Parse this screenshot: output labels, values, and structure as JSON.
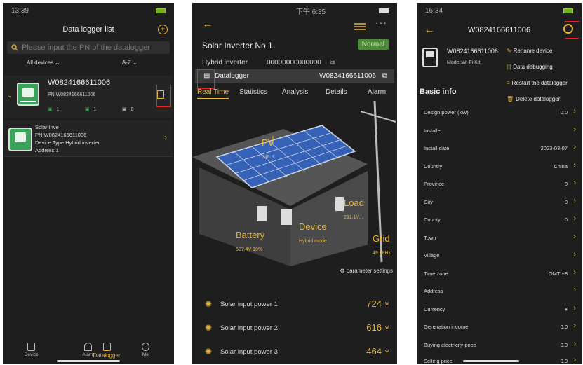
{
  "phone1": {
    "status_time": "13:39",
    "title": "Data logger list",
    "search_placeholder": "Please input the PN of the datalogger",
    "filter_devices": "All devices",
    "filter_sort": "A-Z",
    "datalogger": {
      "name": "W0824166611006",
      "pn": "PN:W0824166611006",
      "stat1": "1",
      "stat2": "1",
      "stat3": "0"
    },
    "device": {
      "name": "Solar Inve",
      "pn": "PN:W0824166611006",
      "type": "Device Type:Hybrid inverter",
      "address": "Address:1"
    },
    "tabs": [
      "Device",
      "Datalogger",
      "Alarm",
      "Me"
    ]
  },
  "phone2": {
    "status_time": "下午 6:35",
    "title": "Solar Inverter No.1",
    "status_badge": "Normal",
    "hybrid_label": "Hybrid inverter",
    "hybrid_sn": "00000000000000",
    "datalogger_label": "Datalogger",
    "datalogger_sn": "W0824166611006",
    "tabs": [
      "Real Time",
      "Statistics",
      "Analysis",
      "Details",
      "Alarm"
    ],
    "scene": {
      "pv_label": "PV",
      "pv_value": "746.8...",
      "load_label": "Load",
      "load_value": "231.1V...",
      "battery_label": "Battery",
      "battery_value": "627.4V  19%",
      "device_label": "Device",
      "device_mode": "Hybrid mode",
      "grid_label": "Grid",
      "grid_value": "49.98Hz"
    },
    "param_settings": "parameter settings",
    "power_rows": [
      {
        "label": "Solar input power 1",
        "value": "724",
        "unit": "w"
      },
      {
        "label": "Solar input power 2",
        "value": "616",
        "unit": "w"
      },
      {
        "label": "Solar input power 3",
        "value": "464",
        "unit": "w"
      }
    ]
  },
  "phone3": {
    "status_time": "16:34",
    "title": "W0824166611006",
    "device_name": "W0824166611006",
    "model": "Model:Wi-Fi Kit",
    "actions": [
      "Rename device",
      "Data debugging",
      "Restart the datalogger",
      "Delete datalogger"
    ],
    "section": "Basic info",
    "fields": [
      {
        "key": "Design power (kW)",
        "value": "0.0"
      },
      {
        "key": "Installer",
        "value": ""
      },
      {
        "key": "Install date",
        "value": "2023-03-07"
      },
      {
        "key": "Country",
        "value": "China"
      },
      {
        "key": "Province",
        "value": "0"
      },
      {
        "key": "City",
        "value": "0"
      },
      {
        "key": "County",
        "value": "0"
      },
      {
        "key": "Town",
        "value": ""
      },
      {
        "key": "Village",
        "value": ""
      },
      {
        "key": "Time zone",
        "value": "GMT +8"
      },
      {
        "key": "Address",
        "value": ""
      },
      {
        "key": "Currency",
        "value": "¥"
      },
      {
        "key": "Generation income",
        "value": "0.0"
      },
      {
        "key": "Buying electricity price",
        "value": "0.0"
      },
      {
        "key": "Selling price",
        "value": "0.0"
      }
    ]
  },
  "colors": {
    "accent": "#e8b73a",
    "highlight": "#e32626",
    "inverter_green": "#3aa35a"
  }
}
